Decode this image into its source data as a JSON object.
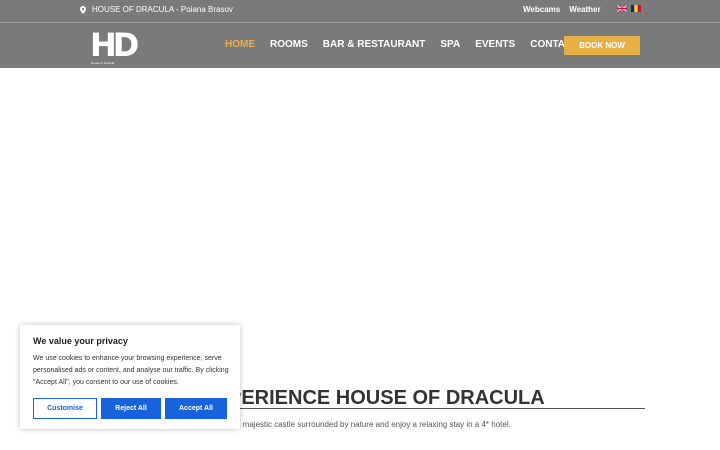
{
  "topbar": {
    "location": "HOUSE OF DRACULA - Poiana Brasov",
    "links": [
      "Webcams",
      "Weather"
    ],
    "languages": [
      "en-flag-icon",
      "ro-flag-icon"
    ]
  },
  "header": {
    "logo_text": "HD",
    "logo_sub": "House of Dracula",
    "nav": [
      {
        "label": "HOME",
        "active": true
      },
      {
        "label": "ROOMS",
        "active": false
      },
      {
        "label": "BAR & RESTAURANT",
        "active": false
      },
      {
        "label": "SPA",
        "active": false
      },
      {
        "label": "EVENTS",
        "active": false
      },
      {
        "label": "CONTACT",
        "active": false
      }
    ],
    "book_label": "BOOK NOW"
  },
  "main": {
    "heading": "PERIENCE HOUSE OF DRACULA",
    "description": "a majestic castle surrounded by nature and enjoy a relaxing stay in a 4* hotel."
  },
  "cookie": {
    "title": "We value your privacy",
    "text": "We use cookies to enhance your browsing experience, serve personalised ads or content, and analyse our traffic. By clicking \"Accept All\", you consent to our use of cookies.",
    "customise_label": "Customise",
    "reject_label": "Reject All",
    "accept_label": "Accept All"
  },
  "colors": {
    "header_bg": "#7a7a7a",
    "accent": "#e6b044",
    "cookie_blue": "#1863dc"
  }
}
